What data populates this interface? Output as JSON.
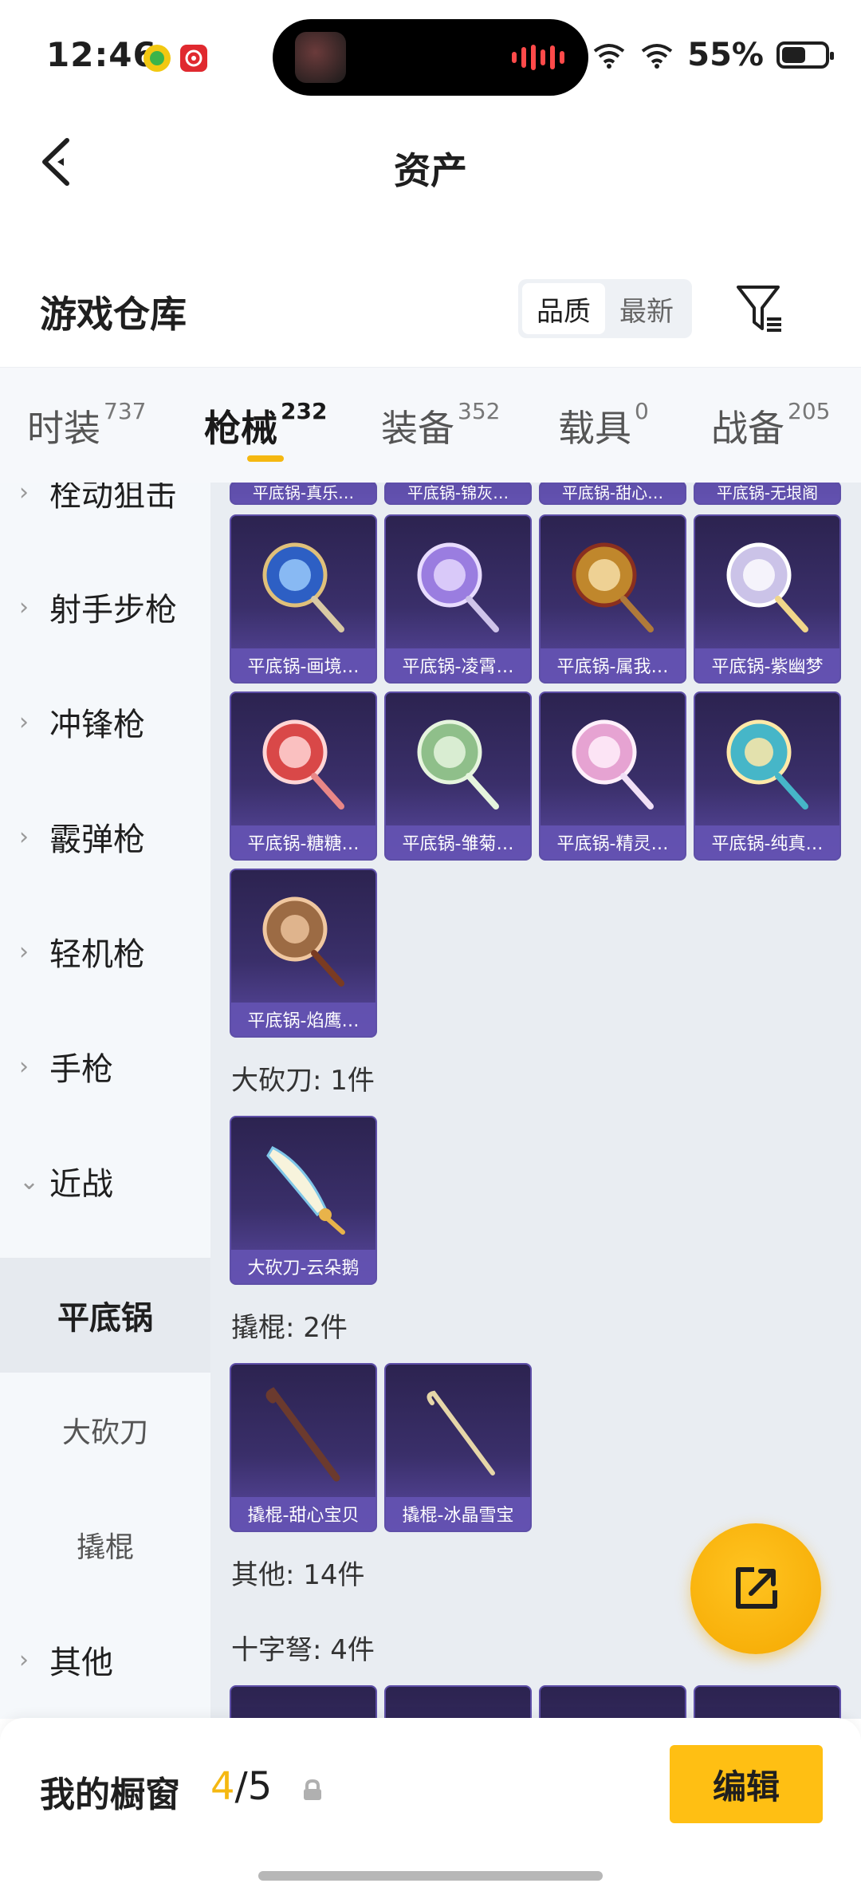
{
  "status_bar": {
    "time": "12:46",
    "battery_text": "55%",
    "battery_level": 0.55,
    "icons": [
      "app-notification-icon",
      "netease-music-icon",
      "wifi-icon",
      "signal-icon",
      "battery-icon"
    ]
  },
  "header": {
    "title": "资产"
  },
  "warehouse": {
    "title": "游戏仓库",
    "sort_options": [
      "品质",
      "最新"
    ],
    "active_sort": "品质"
  },
  "category_tabs": [
    {
      "label": "时装",
      "count": "737"
    },
    {
      "label": "枪械",
      "count": "232",
      "active": true
    },
    {
      "label": "装备",
      "count": "352"
    },
    {
      "label": "载具",
      "count": "0"
    },
    {
      "label": "战备",
      "count": "205"
    }
  ],
  "sidebar": {
    "items": [
      {
        "label": "栓动狙击",
        "chevron": "›"
      },
      {
        "label": "射手步枪",
        "chevron": "›"
      },
      {
        "label": "冲锋枪",
        "chevron": "›"
      },
      {
        "label": "霰弹枪",
        "chevron": "›"
      },
      {
        "label": "轻机枪",
        "chevron": "›"
      },
      {
        "label": "手枪",
        "chevron": "›"
      },
      {
        "label": "近战",
        "chevron": "⌄"
      }
    ],
    "sub_items": [
      {
        "label": "平底锅",
        "active": true
      },
      {
        "label": "大砍刀"
      },
      {
        "label": "撬棍"
      }
    ],
    "other": {
      "label": "其他",
      "chevron": "›"
    }
  },
  "content": {
    "cut_row": [
      "平底锅-真乐…",
      "平底锅-锦灰…",
      "平底锅-甜心…",
      "平底锅-无垠阁"
    ],
    "pan_items": [
      {
        "label": "平底锅-画境…",
        "colors": [
          "#2d5fc4",
          "#9fd0ff"
        ]
      },
      {
        "label": "平底锅-凌霄…",
        "colors": [
          "#9a7de0",
          "#e8dcff"
        ]
      },
      {
        "label": "平底锅-属我…",
        "colors": [
          "#c0872c",
          "#f3d9a0"
        ]
      },
      {
        "label": "平底锅-紫幽梦",
        "colors": [
          "#cbc3e8",
          "#ffffff"
        ]
      },
      {
        "label": "平底锅-糖糖…",
        "colors": [
          "#d94848",
          "#ffd6d6"
        ]
      },
      {
        "label": "平底锅-雏菊…",
        "colors": [
          "#8fbf8a",
          "#e6f5de"
        ]
      },
      {
        "label": "平底锅-精灵…",
        "colors": [
          "#e6a3d2",
          "#fff0fb"
        ]
      },
      {
        "label": "平底锅-纯真…",
        "colors": [
          "#46b6c8",
          "#ffe9a8"
        ]
      },
      {
        "label": "平底锅-焰鹰…",
        "colors": [
          "#9c6b44",
          "#f0c7a0"
        ]
      }
    ],
    "groups": [
      {
        "title": "大砍刀: 1件",
        "items": [
          {
            "label": "大砍刀-云朵鹅"
          }
        ]
      },
      {
        "title": "撬棍: 2件",
        "items": [
          {
            "label": "撬棍-甜心宝贝"
          },
          {
            "label": "撬棍-冰晶雪宝"
          }
        ]
      },
      {
        "title": "其他: 14件"
      },
      {
        "title": "十字弩: 4件"
      }
    ]
  },
  "fab": {
    "icon": "share-external-icon"
  },
  "bottom_bar": {
    "label": "我的橱窗",
    "count_current": "4",
    "count_sep": "/",
    "count_total": "5",
    "edit_label": "编辑"
  }
}
